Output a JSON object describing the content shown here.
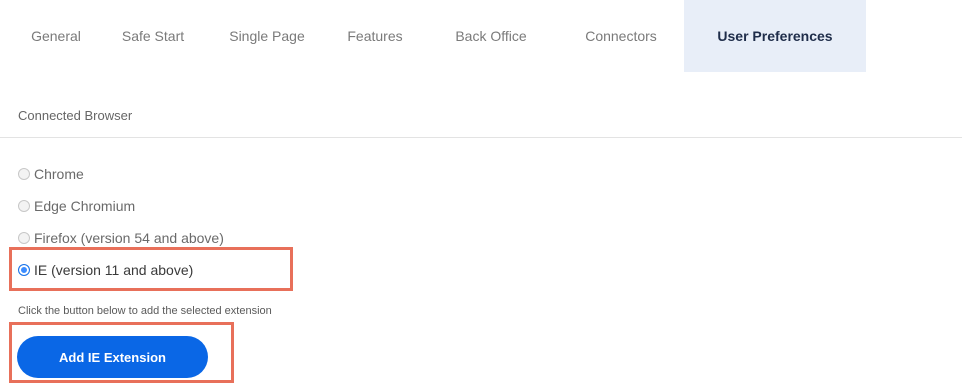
{
  "tabs": [
    {
      "label": "General"
    },
    {
      "label": "Safe Start"
    },
    {
      "label": "Single Page"
    },
    {
      "label": "Features"
    },
    {
      "label": "Back Office"
    },
    {
      "label": "Connectors"
    },
    {
      "label": "User Preferences",
      "active": true
    }
  ],
  "section": {
    "label": "Connected Browser"
  },
  "browser_options": [
    {
      "label": "Chrome",
      "selected": false
    },
    {
      "label": "Edge Chromium",
      "selected": false
    },
    {
      "label": "Firefox (version 54 and above)",
      "selected": false
    },
    {
      "label": "IE (version 11 and above)",
      "selected": true
    }
  ],
  "helper_text": "Click the button below to add the selected extension",
  "add_button": {
    "label": "Add IE Extension"
  },
  "colors": {
    "accent": "#0a67e6",
    "active_tab_bg": "#e8eef8",
    "highlight": "#e8705a"
  }
}
